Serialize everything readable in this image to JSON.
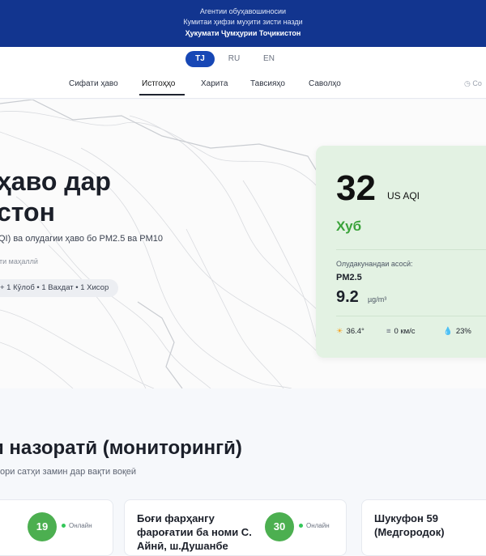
{
  "header": {
    "line1": "Агентии обуҳавошиносии",
    "line2": "Кумитаи ҳифзи муҳити зисти назди",
    "line3": "Ҳукумати Ҷумҳурии Тоҷикистон"
  },
  "languages": [
    {
      "code": "TJ",
      "active": true
    },
    {
      "code": "RU",
      "active": false
    },
    {
      "code": "EN",
      "active": false
    }
  ],
  "nav": {
    "items": [
      "Сифати ҳаво",
      "Истгоҳҳо",
      "Харита",
      "Тавсияҳо",
      "Саволҳо"
    ],
    "active": "Истгоҳҳо",
    "right_text": "Со"
  },
  "hero": {
    "title_line1": "ҳаво дар",
    "title_line2": "стон",
    "subtitle": "QI) ва олудагии ҳаво бо PM2.5 ва PM10",
    "note": "ти маҳаллӣ",
    "chip": "+ 1 Кӯлоб • 1 Вахдат • 1 Хисор"
  },
  "aqi_card": {
    "value": "32",
    "unit": "US AQI",
    "status": "Хуб",
    "status_color": "#3aa33a",
    "pollutant_label": "Олудакунандаи асосӣ:",
    "pollutant_name": "PM2.5",
    "pollutant_value": "9.2",
    "pollutant_unit": "µg/m³",
    "weather": {
      "temperature": "36.4°",
      "wind": "0 км/с",
      "humidity": "23%"
    }
  },
  "monitoring": {
    "title": "и назоратӣ (мониторингӣ)",
    "subtitle": "ори сатҳи замин дар вақти воқеӣ",
    "stations": [
      {
        "name": "",
        "aqi": "19",
        "status": "Онлайн"
      },
      {
        "name_line1": "Боғи фарҳангу",
        "name_line2": "фароғатии ба номи С.",
        "name_line3": "Айнӣ, ш.Душанбе",
        "aqi": "30",
        "status": "Онлайн"
      },
      {
        "name_line1": "Шукуфон 59",
        "name_line2": "(Медгородок)",
        "aqi": "",
        "status": ""
      }
    ]
  },
  "colors": {
    "header_bg": "#12358f",
    "lang_active": "#1747b5",
    "card_bg": "#e3f2e3",
    "badge_good": "#4caf50"
  }
}
